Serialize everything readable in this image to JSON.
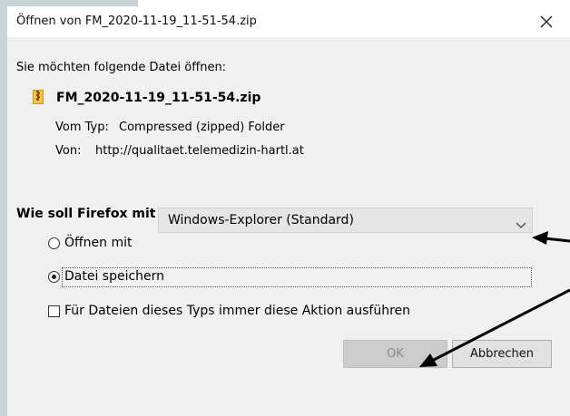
{
  "window": {
    "title": "Öffnen von FM_2020-11-19_11-51-54.zip",
    "close_icon": "close-icon"
  },
  "intro": "Sie möchten folgende Datei öffnen:",
  "file": {
    "name": "FM_2020-11-19_11-51-54.zip",
    "icon": "zip-folder-icon",
    "type_label": "Vom Typ:",
    "type_value": "Compressed (zipped) Folder",
    "from_label": "Von:",
    "from_value": "http://qualitaet.telemedizin-hartl.at"
  },
  "action": {
    "question": "Wie soll Firefox mit dieser Datei verfahren?",
    "open_with_label": "Öffnen mit",
    "open_with_selected": "Windows-Explorer (Standard)",
    "open_with_checked": false,
    "save_label": "Datei speichern",
    "save_checked": true,
    "always_label": "Für Dateien dieses Typs immer diese Aktion ausführen",
    "always_checked": false
  },
  "buttons": {
    "ok": "OK",
    "cancel": "Abbrechen"
  },
  "colors": {
    "dialog_bg": "#f0f0f0",
    "select_bg": "#e5e5e5",
    "ok_disabled_bg": "#cccccc",
    "annotation_arrow": "#000000"
  }
}
